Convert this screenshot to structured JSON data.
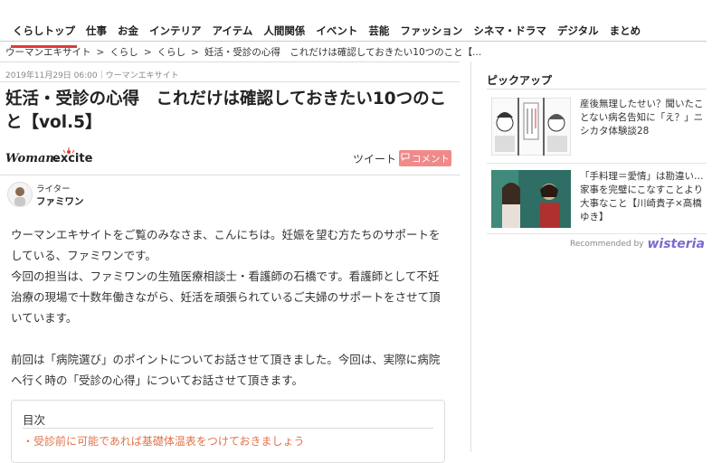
{
  "nav": {
    "items": [
      {
        "label": "くらしトップ",
        "active": true
      },
      {
        "label": "仕事"
      },
      {
        "label": "お金"
      },
      {
        "label": "インテリア"
      },
      {
        "label": "アイテム"
      },
      {
        "label": "人間関係"
      },
      {
        "label": "イベント"
      },
      {
        "label": "芸能"
      },
      {
        "label": "ファッション"
      },
      {
        "label": "シネマ・ドラマ"
      },
      {
        "label": "デジタル"
      },
      {
        "label": "まとめ"
      }
    ]
  },
  "breadcrumb": {
    "items": [
      "ウーマンエキサイト",
      "くらし",
      "くらし",
      "妊活・受診の心得　これだけは確認しておきたい10つのこと【..."
    ],
    "separator": ">"
  },
  "article": {
    "meta": "2019年11月29日 06:00｜ウーマンエキサイト",
    "title": "妊活・受診の心得　これだけは確認しておきたい10つのこと【vol.5】",
    "logo_text": "Woman.excite",
    "tweet_label": "ツイート",
    "comment_label": "コメント",
    "writer_label": "ライター",
    "writer_name": "ファミワン",
    "paragraphs": [
      "ウーマンエキサイトをご覧のみなさま、こんにちは。妊娠を望む方たちのサポートをしている、ファミワンです。",
      "今回の担当は、ファミワンの生殖医療相談士・看護師の石橋です。看護師として不妊治療の現場で十数年働きながら、妊活を頑張られているご夫婦のサポートをさせて頂いています。",
      "",
      "前回は「病院選び」のポイントについてお話させて頂きました。今回は、実際に病院へ行く時の「受診の心得」についてお話させて頂きます。"
    ],
    "toc_title": "目次",
    "toc_items": [
      "・受診前に可能であれば基礎体温表をつけておきましょう"
    ]
  },
  "sidebar": {
    "pickup_title": "ピックアップ",
    "items": [
      {
        "text": "産後無理したせい？聞いたことない病名告知に「え？」ニシカタ体験談28"
      },
      {
        "text": "「手料理＝愛情」は勘違い…家事を完璧にこなすことより大事なこと【川崎貴子×高橋ゆき】"
      }
    ],
    "recommended_text": "Recommended by",
    "recommended_brand": "wisteria"
  },
  "colors": {
    "accent": "#e03a3a",
    "comment_bg": "#f08a8a",
    "toc_link": "#e0734a"
  }
}
